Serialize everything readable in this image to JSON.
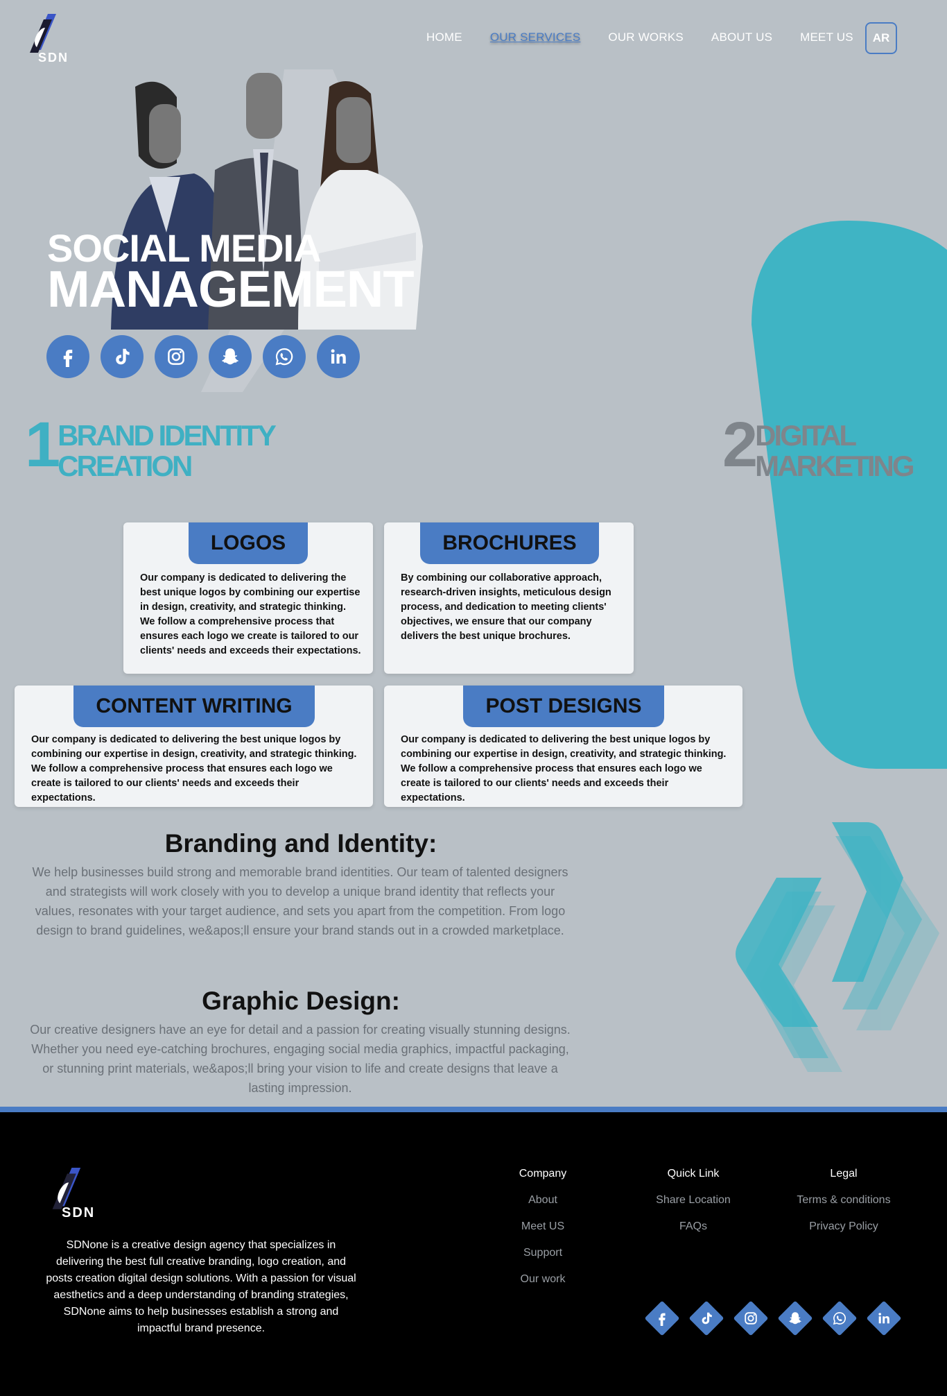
{
  "nav": {
    "logo_text": "SDN",
    "items": [
      "HOME",
      "OUR SERVICES",
      "OUR WORKS",
      "ABOUT US",
      "MEET US"
    ],
    "active": "OUR SERVICES",
    "lang_button": "AR"
  },
  "hero": {
    "title_line1": "SOCIAL MEDIA",
    "title_line2": "MANAGEMENT",
    "social_icons": [
      "facebook-icon",
      "tiktok-icon",
      "instagram-icon",
      "snapchat-icon",
      "whatsapp-icon",
      "linkedin-icon"
    ]
  },
  "services": {
    "one": {
      "num": "1",
      "line1": "BRAND IDENTITY",
      "line2": "CREATION"
    },
    "two": {
      "num": "2",
      "line1": "DIGITAL",
      "line2": "MARKETING"
    }
  },
  "cards": {
    "logos": {
      "title": "LOGOS",
      "text": "Our company is dedicated to delivering the best unique logos by combining our expertise in design, creativity, and strategic thinking. We follow a comprehensive process that ensures each logo we create is tailored to our clients' needs and exceeds their expectations."
    },
    "brochures": {
      "title": "BROCHURES",
      "text": "By combining our collaborative approach, research-driven insights, meticulous design process, and dedication to meeting clients' objectives, we ensure that our company delivers the best unique brochures."
    },
    "content": {
      "title": "CONTENT WRITING",
      "text": "Our company is dedicated to delivering the best unique logos by combining our expertise in design, creativity, and strategic thinking. We follow a comprehensive process that ensures each logo we create is tailored to our clients' needs and exceeds their expectations."
    },
    "posts": {
      "title": "POST DESIGNS",
      "text": "Our company is dedicated to delivering the best unique logos by combining our expertise in design, creativity, and strategic thinking. We follow a comprehensive process that ensures each logo we create is tailored to our clients' needs and exceeds their expectations."
    }
  },
  "branding": {
    "title": "Branding and Identity:",
    "body": "We help businesses build strong and memorable brand identities. Our team of talented designers and strategists will work closely with you to develop a unique brand identity that reflects your values, resonates with your target audience, and sets you apart from the competition. From logo design to brand guidelines, we&apos;ll ensure your brand stands out in a crowded marketplace."
  },
  "graphic": {
    "title": "Graphic Design:",
    "body": "Our creative designers have an eye for detail and a passion for creating visually stunning designs. Whether you need eye-catching brochures, engaging social media graphics, impactful packaging, or stunning print materials, we&apos;ll bring your vision to life and create designs that leave a lasting impression."
  },
  "footer": {
    "logo_text": "SDN",
    "about": "SDNone is a creative design agency that specializes in delivering the best full creative branding, logo creation, and posts creation digital design solutions. With a passion for visual aesthetics and a deep understanding of branding strategies, SDNone aims to help businesses establish a strong and impactful brand presence.",
    "company": {
      "title": "Company",
      "links": [
        "About",
        "Meet US",
        "Support",
        "Our work"
      ]
    },
    "quick": {
      "title": "Quick Link",
      "links": [
        "Share Location",
        "FAQs"
      ]
    },
    "legal": {
      "title": "Legal",
      "links": [
        "Terms & conditions",
        "Privacy Policy"
      ]
    },
    "social_icons": [
      "facebook-icon",
      "tiktok-icon",
      "instagram-icon",
      "snapchat-icon",
      "whatsapp-icon",
      "linkedin-icon"
    ]
  },
  "colors": {
    "accent": "#4a7cc4",
    "teal": "#3fb0c3",
    "background": "#b9c0c6",
    "footer": "#000000"
  }
}
